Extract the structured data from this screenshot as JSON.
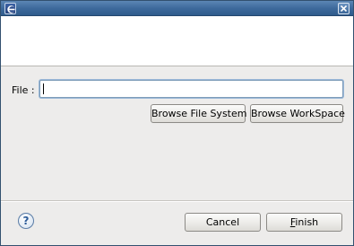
{
  "window": {
    "title": "",
    "icon": "eclipse-app-icon",
    "close_icon": "close-icon"
  },
  "banner": {
    "title": "",
    "message": ""
  },
  "form": {
    "file_label": "File :",
    "file_value": "",
    "browse_file_system_label": "Browse File System",
    "browse_workspace_label": "Browse WorkSpace"
  },
  "footer": {
    "help_icon": "help-icon",
    "help_glyph": "?",
    "cancel_label": "Cancel",
    "finish_mnemonic": "F",
    "finish_rest": "inish"
  },
  "colors": {
    "titlebar": "#3e6a9c",
    "dialog_background": "#edeceb",
    "input_border": "#7f9db9"
  }
}
